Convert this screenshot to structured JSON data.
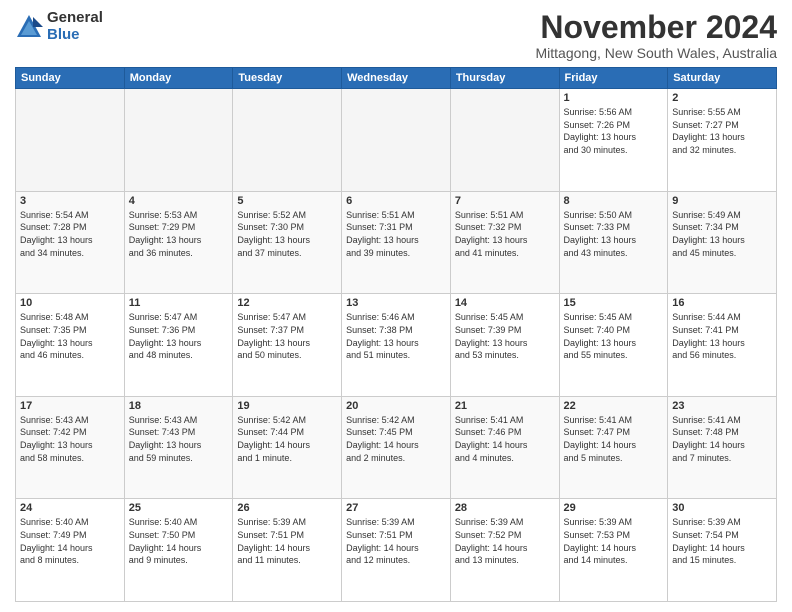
{
  "logo": {
    "general": "General",
    "blue": "Blue"
  },
  "header": {
    "month": "November 2024",
    "location": "Mittagong, New South Wales, Australia"
  },
  "weekdays": [
    "Sunday",
    "Monday",
    "Tuesday",
    "Wednesday",
    "Thursday",
    "Friday",
    "Saturday"
  ],
  "weeks": [
    [
      {
        "day": "",
        "info": ""
      },
      {
        "day": "",
        "info": ""
      },
      {
        "day": "",
        "info": ""
      },
      {
        "day": "",
        "info": ""
      },
      {
        "day": "",
        "info": ""
      },
      {
        "day": "1",
        "info": "Sunrise: 5:56 AM\nSunset: 7:26 PM\nDaylight: 13 hours\nand 30 minutes."
      },
      {
        "day": "2",
        "info": "Sunrise: 5:55 AM\nSunset: 7:27 PM\nDaylight: 13 hours\nand 32 minutes."
      }
    ],
    [
      {
        "day": "3",
        "info": "Sunrise: 5:54 AM\nSunset: 7:28 PM\nDaylight: 13 hours\nand 34 minutes."
      },
      {
        "day": "4",
        "info": "Sunrise: 5:53 AM\nSunset: 7:29 PM\nDaylight: 13 hours\nand 36 minutes."
      },
      {
        "day": "5",
        "info": "Sunrise: 5:52 AM\nSunset: 7:30 PM\nDaylight: 13 hours\nand 37 minutes."
      },
      {
        "day": "6",
        "info": "Sunrise: 5:51 AM\nSunset: 7:31 PM\nDaylight: 13 hours\nand 39 minutes."
      },
      {
        "day": "7",
        "info": "Sunrise: 5:51 AM\nSunset: 7:32 PM\nDaylight: 13 hours\nand 41 minutes."
      },
      {
        "day": "8",
        "info": "Sunrise: 5:50 AM\nSunset: 7:33 PM\nDaylight: 13 hours\nand 43 minutes."
      },
      {
        "day": "9",
        "info": "Sunrise: 5:49 AM\nSunset: 7:34 PM\nDaylight: 13 hours\nand 45 minutes."
      }
    ],
    [
      {
        "day": "10",
        "info": "Sunrise: 5:48 AM\nSunset: 7:35 PM\nDaylight: 13 hours\nand 46 minutes."
      },
      {
        "day": "11",
        "info": "Sunrise: 5:47 AM\nSunset: 7:36 PM\nDaylight: 13 hours\nand 48 minutes."
      },
      {
        "day": "12",
        "info": "Sunrise: 5:47 AM\nSunset: 7:37 PM\nDaylight: 13 hours\nand 50 minutes."
      },
      {
        "day": "13",
        "info": "Sunrise: 5:46 AM\nSunset: 7:38 PM\nDaylight: 13 hours\nand 51 minutes."
      },
      {
        "day": "14",
        "info": "Sunrise: 5:45 AM\nSunset: 7:39 PM\nDaylight: 13 hours\nand 53 minutes."
      },
      {
        "day": "15",
        "info": "Sunrise: 5:45 AM\nSunset: 7:40 PM\nDaylight: 13 hours\nand 55 minutes."
      },
      {
        "day": "16",
        "info": "Sunrise: 5:44 AM\nSunset: 7:41 PM\nDaylight: 13 hours\nand 56 minutes."
      }
    ],
    [
      {
        "day": "17",
        "info": "Sunrise: 5:43 AM\nSunset: 7:42 PM\nDaylight: 13 hours\nand 58 minutes."
      },
      {
        "day": "18",
        "info": "Sunrise: 5:43 AM\nSunset: 7:43 PM\nDaylight: 13 hours\nand 59 minutes."
      },
      {
        "day": "19",
        "info": "Sunrise: 5:42 AM\nSunset: 7:44 PM\nDaylight: 14 hours\nand 1 minute."
      },
      {
        "day": "20",
        "info": "Sunrise: 5:42 AM\nSunset: 7:45 PM\nDaylight: 14 hours\nand 2 minutes."
      },
      {
        "day": "21",
        "info": "Sunrise: 5:41 AM\nSunset: 7:46 PM\nDaylight: 14 hours\nand 4 minutes."
      },
      {
        "day": "22",
        "info": "Sunrise: 5:41 AM\nSunset: 7:47 PM\nDaylight: 14 hours\nand 5 minutes."
      },
      {
        "day": "23",
        "info": "Sunrise: 5:41 AM\nSunset: 7:48 PM\nDaylight: 14 hours\nand 7 minutes."
      }
    ],
    [
      {
        "day": "24",
        "info": "Sunrise: 5:40 AM\nSunset: 7:49 PM\nDaylight: 14 hours\nand 8 minutes."
      },
      {
        "day": "25",
        "info": "Sunrise: 5:40 AM\nSunset: 7:50 PM\nDaylight: 14 hours\nand 9 minutes."
      },
      {
        "day": "26",
        "info": "Sunrise: 5:39 AM\nSunset: 7:51 PM\nDaylight: 14 hours\nand 11 minutes."
      },
      {
        "day": "27",
        "info": "Sunrise: 5:39 AM\nSunset: 7:51 PM\nDaylight: 14 hours\nand 12 minutes."
      },
      {
        "day": "28",
        "info": "Sunrise: 5:39 AM\nSunset: 7:52 PM\nDaylight: 14 hours\nand 13 minutes."
      },
      {
        "day": "29",
        "info": "Sunrise: 5:39 AM\nSunset: 7:53 PM\nDaylight: 14 hours\nand 14 minutes."
      },
      {
        "day": "30",
        "info": "Sunrise: 5:39 AM\nSunset: 7:54 PM\nDaylight: 14 hours\nand 15 minutes."
      }
    ]
  ]
}
